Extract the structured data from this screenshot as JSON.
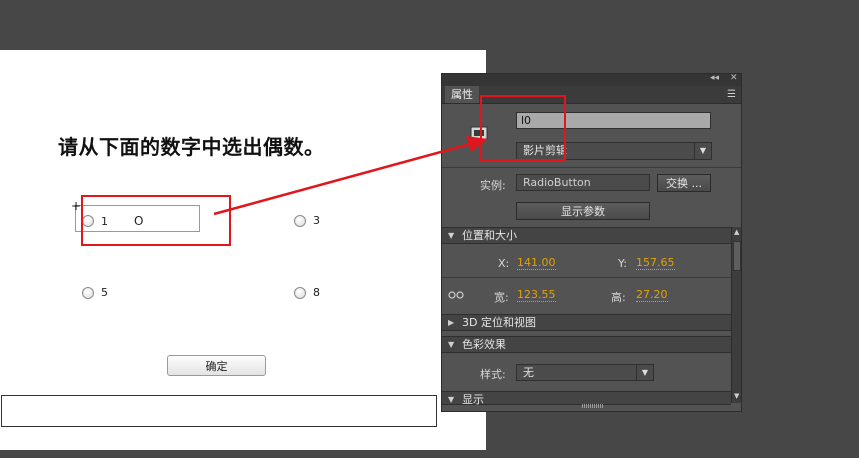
{
  "stage": {
    "question": "请从下面的数字中选出偶数。",
    "options": [
      {
        "label": "1",
        "extra": "O"
      },
      {
        "label": "3"
      },
      {
        "label": "5"
      },
      {
        "label": "8"
      }
    ],
    "confirm_label": "确定",
    "crosshair": "+"
  },
  "panel": {
    "tab_label": "属性",
    "collapse_glyph": "◂◂",
    "close_glyph": "✕",
    "menu_glyph": "☰",
    "instance_name": "l0",
    "symbol_type": "影片剪辑",
    "instance_label": "实例:",
    "instance_value": "RadioButton",
    "swap_button": "交换 ...",
    "show_params_button": "显示参数",
    "section_position": "位置和大小",
    "x_label": "X:",
    "x_value": "141.00",
    "y_label": "Y:",
    "y_value": "157.65",
    "w_label": "宽:",
    "w_value": "123.55",
    "h_label": "高:",
    "h_value": "27.20",
    "section_3d": "3D 定位和视图",
    "section_color": "色彩效果",
    "style_label": "样式:",
    "style_value": "无",
    "section_display": "显示"
  },
  "colors": {
    "annotation": "#e0161c",
    "value_orange": "#e2a200",
    "selection_cyan": "#36c2d6"
  }
}
